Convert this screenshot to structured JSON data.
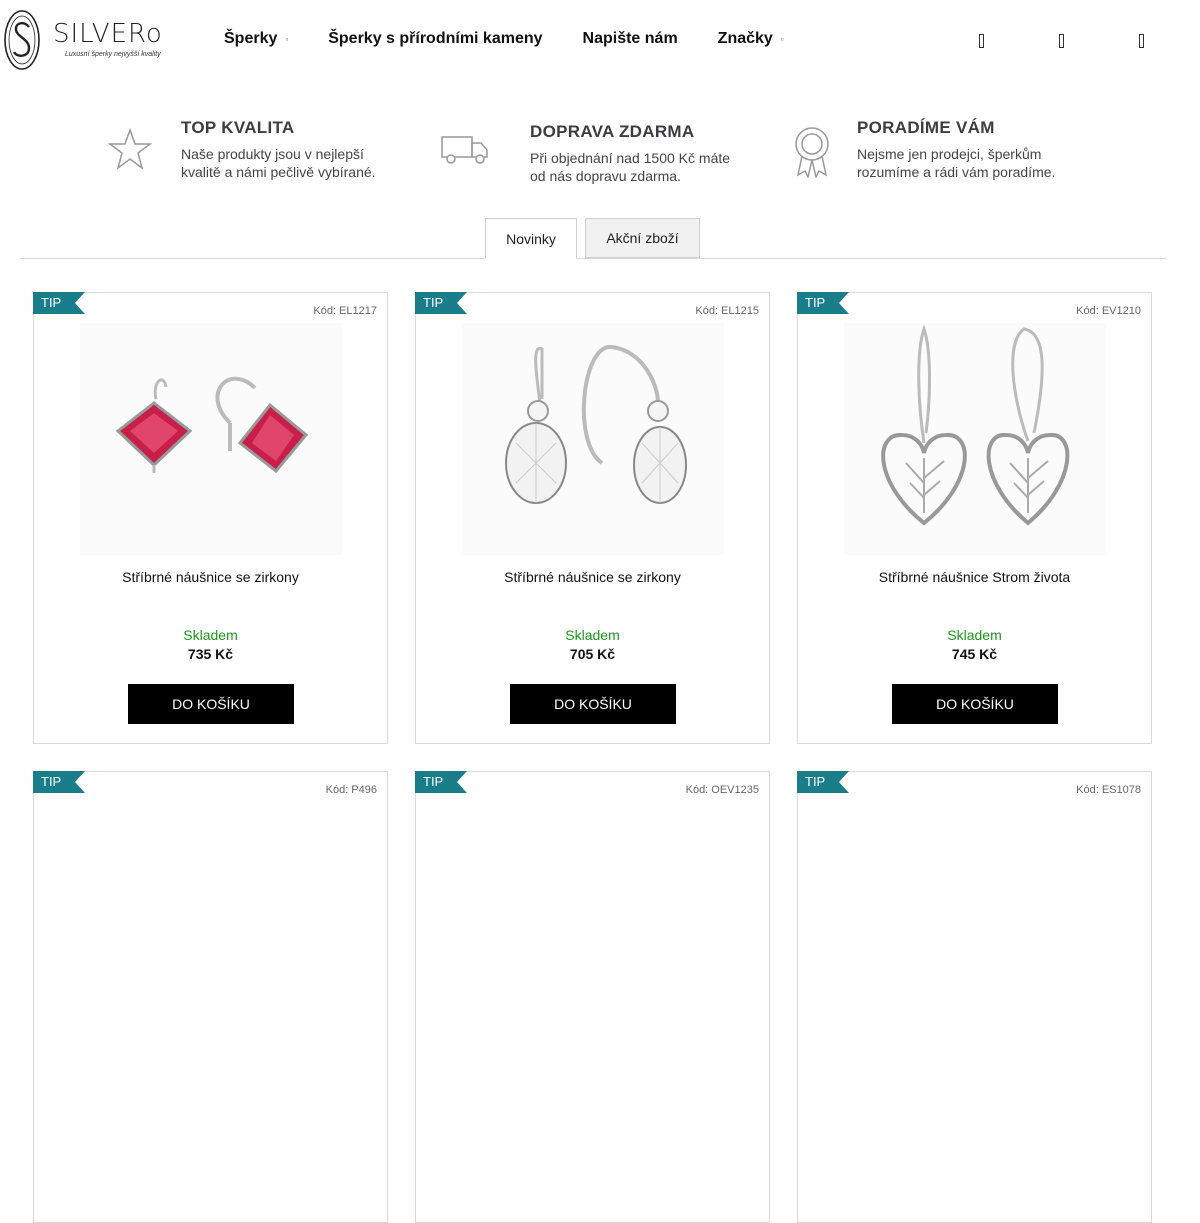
{
  "logo": {
    "name": "SILVERo",
    "tagline": "Luxusní šperky nejvyšší kvality"
  },
  "nav": {
    "items": [
      {
        "label": "Šperky",
        "caret": "▫"
      },
      {
        "label": "Šperky s přírodními kameny",
        "caret": ""
      },
      {
        "label": "Napište nám",
        "caret": ""
      },
      {
        "label": "Značky",
        "caret": "▫"
      }
    ]
  },
  "header_icons": [
    "search-icon",
    "user-icon",
    "cart-icon"
  ],
  "benefits": [
    {
      "icon": "star-icon",
      "title": "TOP KVALITA",
      "line1": "Naše produkty jsou v nejlepší",
      "line2": "kvalitě a námi pečlivě vybírané."
    },
    {
      "icon": "truck-icon",
      "title": "DOPRAVA ZDARMA",
      "line1": "Při objednání nad 1500 Kč máte",
      "line2": "od nás dopravu zdarma."
    },
    {
      "icon": "award-icon",
      "title": "PORADÍME VÁM",
      "line1": "Nejsme jen prodejci, šperkům",
      "line2": "rozumíme a rádi vám poradíme."
    }
  ],
  "tabs": [
    {
      "label": "Novinky",
      "active": true
    },
    {
      "label": "Akční zboží",
      "active": false
    }
  ],
  "colors": {
    "tip_badge": "#1a7d8a",
    "in_stock": "#1a9a1a",
    "buy_button": "#000000",
    "ruby": "#c81e4a"
  },
  "products": [
    {
      "badge": "TIP",
      "code": "Kód: EL1217",
      "name": "Stříbrné náušnice se zirkony",
      "stock": "Skladem",
      "price": "735 Kč",
      "button": "DO KOŠÍKU"
    },
    {
      "badge": "TIP",
      "code": "Kód: EL1215",
      "name": "Stříbrné náušnice se zirkony",
      "stock": "Skladem",
      "price": "705 Kč",
      "button": "DO KOŠÍKU"
    },
    {
      "badge": "TIP",
      "code": "Kód: EV1210",
      "name": "Stříbrné náušnice Strom života",
      "stock": "Skladem",
      "price": "745 Kč",
      "button": "DO KOŠÍKU"
    },
    {
      "badge": "TIP",
      "code": "Kód: P496"
    },
    {
      "badge": "TIP",
      "code": "Kód: OEV1235"
    },
    {
      "badge": "TIP",
      "code": "Kód: ES1078"
    }
  ]
}
